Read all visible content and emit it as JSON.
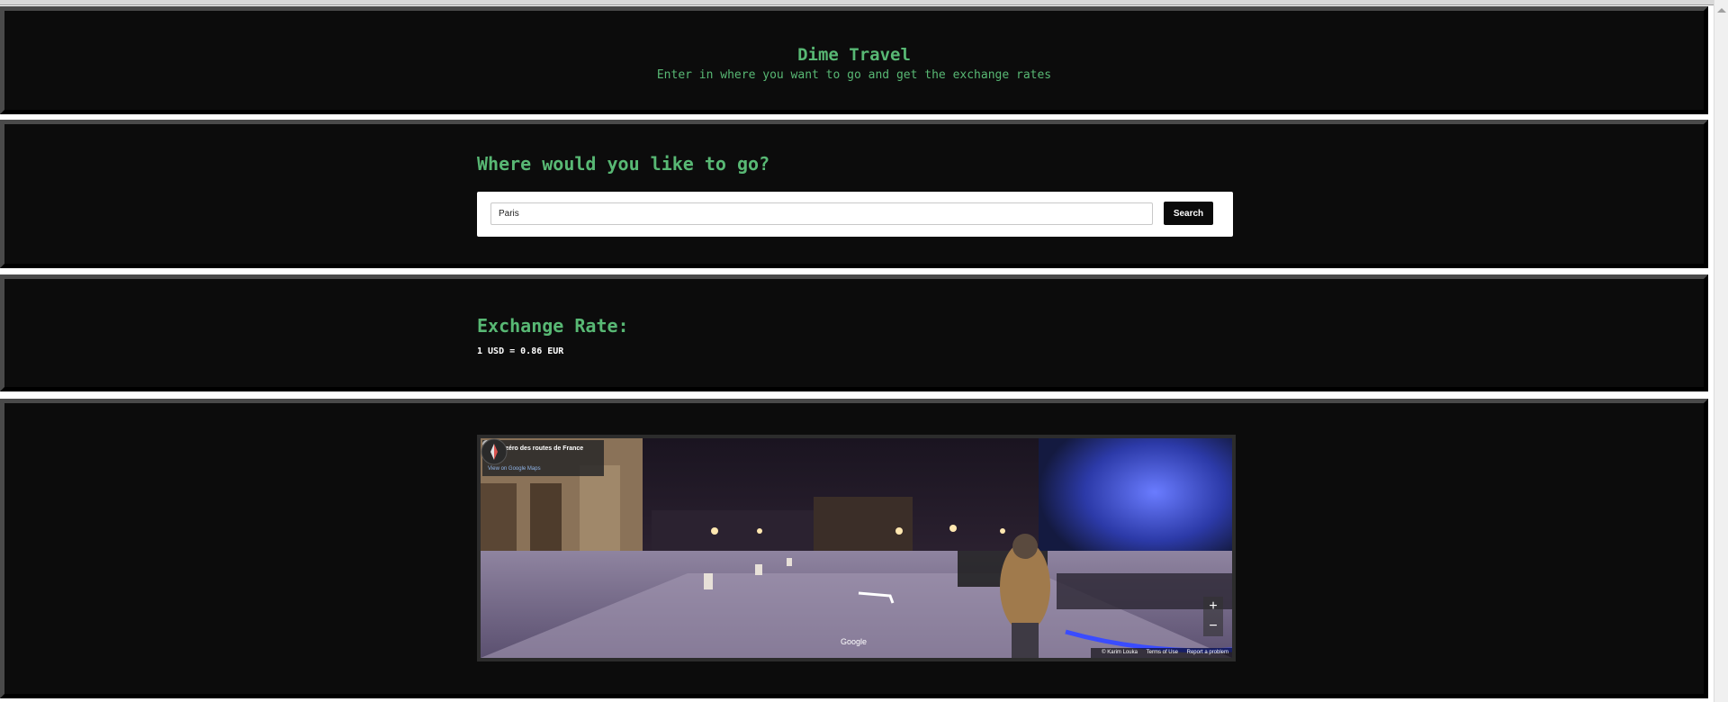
{
  "header": {
    "title": "Dime Travel",
    "subtitle": "Enter in where you want to go and get the exchange rates"
  },
  "search": {
    "heading": "Where would you like to go?",
    "value": "Paris",
    "button_label": "Search"
  },
  "exchange": {
    "heading": "Exchange Rate:",
    "rate_text": "1 USD = 0.86 EUR"
  },
  "streetview": {
    "place_name": "Point zéro des routes de France",
    "view_link": "View on Google Maps",
    "zoom_in": "+",
    "zoom_out": "−",
    "logo": "Google",
    "attribution": "© Karim Louka",
    "terms": "Terms of Use",
    "report": "Report a problem"
  },
  "icons": [
    "map-pin-icon",
    "compass-icon",
    "scroll-up-arrow-icon"
  ],
  "colors": {
    "accent": "#58b874",
    "section_bg": "#0c0c0c",
    "border": "#4a4a4a"
  }
}
